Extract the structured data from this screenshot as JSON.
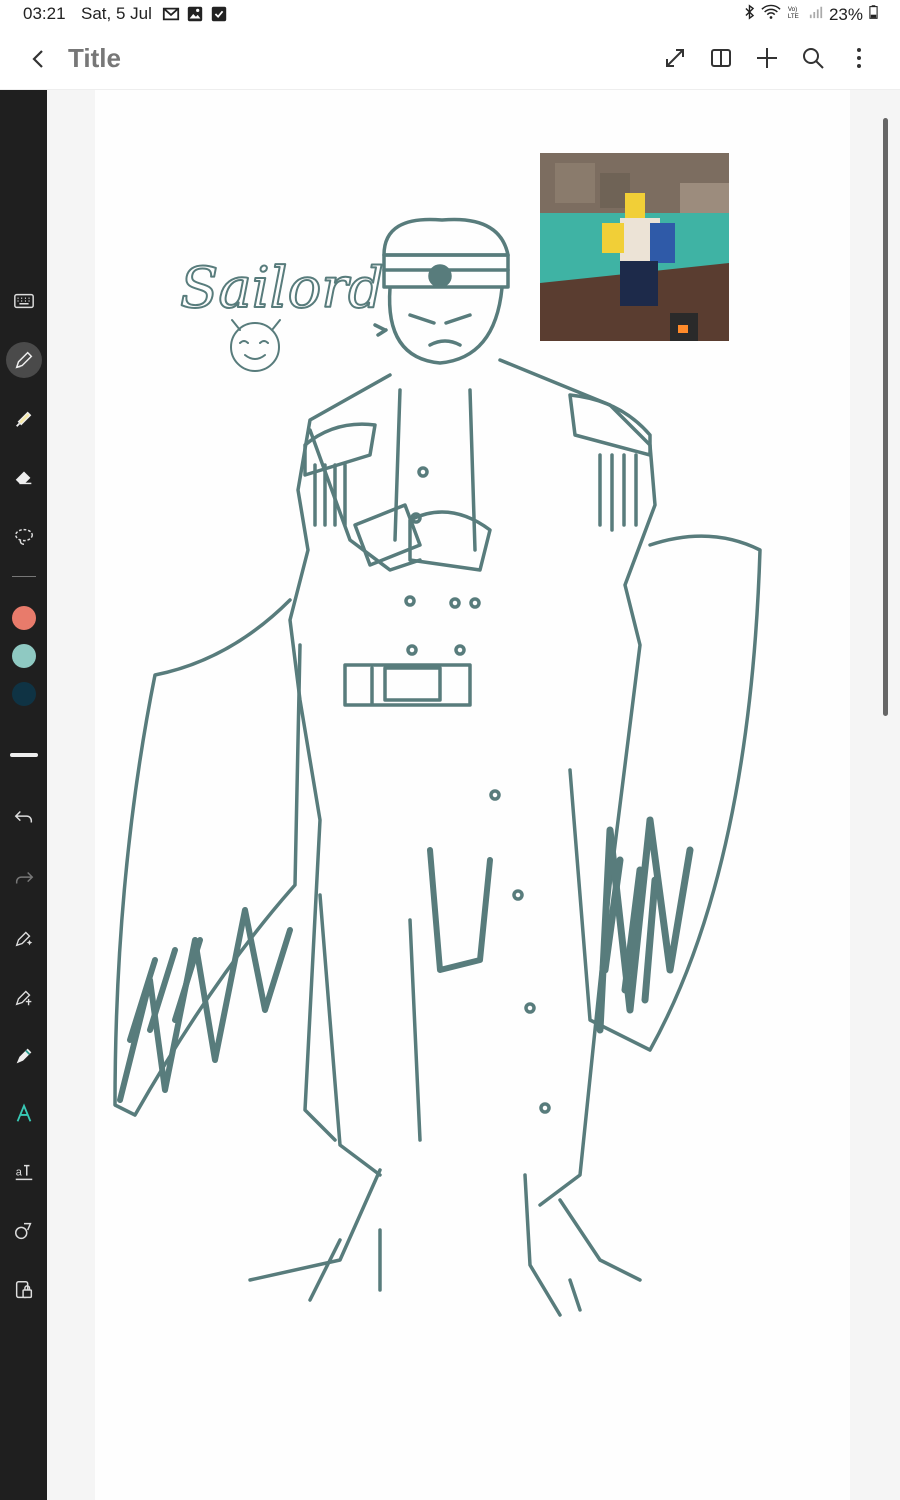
{
  "status_bar": {
    "time": "03:21",
    "date": "Sat, 5 Jul",
    "battery": "23%",
    "icons": [
      "gmail-icon",
      "gallery-icon",
      "task-done-icon",
      "bluetooth-icon",
      "wifi-icon",
      "volte-icon",
      "signal-icon",
      "battery-icon"
    ]
  },
  "app_bar": {
    "title": "Title",
    "actions": [
      "fullscreen-icon",
      "book-view-icon",
      "add-page-icon",
      "search-icon",
      "more-options-icon"
    ]
  },
  "toolbar": {
    "tools": [
      "keyboard-tool",
      "pen-tool",
      "highlighter-tool",
      "eraser-tool",
      "lasso-select-tool"
    ],
    "colors": [
      "#e87b6b",
      "#8fc9c2",
      "#0f3344"
    ],
    "bottom_tools": [
      "undo",
      "redo",
      "ai-assist",
      "shape-pen",
      "pen-edit",
      "handwriting-to-text",
      "text-tool",
      "shapes-tool",
      "lock-tool"
    ],
    "active_tool": "pen-tool"
  },
  "canvas": {
    "handwritten_label": "Sailord",
    "stroke_color": "#587c7c",
    "background": "#fefefe"
  }
}
